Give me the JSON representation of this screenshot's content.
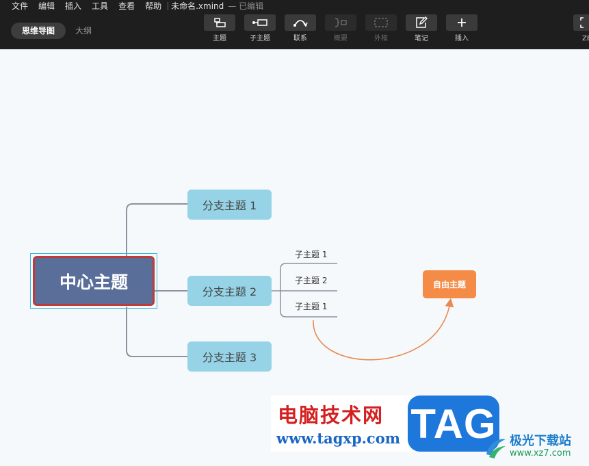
{
  "menu": [
    "文件",
    "编辑",
    "插入",
    "工具",
    "查看",
    "帮助"
  ],
  "document": {
    "filename": "未命名.xmind",
    "status": "— 已编辑"
  },
  "view_tabs": {
    "mindmap": "思维导图",
    "outline": "大纲"
  },
  "toolbar": {
    "topic": "主题",
    "subtopic": "子主题",
    "relationship": "联系",
    "summary": "概要",
    "boundary": "外框",
    "note": "笔记",
    "insert": "插入",
    "zen": "ZE"
  },
  "mindmap": {
    "central": "中心主题",
    "branches": [
      "分支主题 1",
      "分支主题 2",
      "分支主题 3"
    ],
    "subtopics": [
      "子主题 1",
      "子主题 2",
      "子主题 1"
    ],
    "floating": "自由主题"
  },
  "colors": {
    "central_fill": "#5a6e9a",
    "central_border": "#c03a3a",
    "branch_fill": "#96d3e6",
    "floating_fill": "#f48b46",
    "relationship_line": "#e88a4e"
  },
  "watermark": {
    "site_cn": "电脑技术网",
    "site_url": "www.tagxp.com",
    "tag": "TAG",
    "site2_cn": "极光下载站",
    "site2_url": "www.xz7.com"
  }
}
